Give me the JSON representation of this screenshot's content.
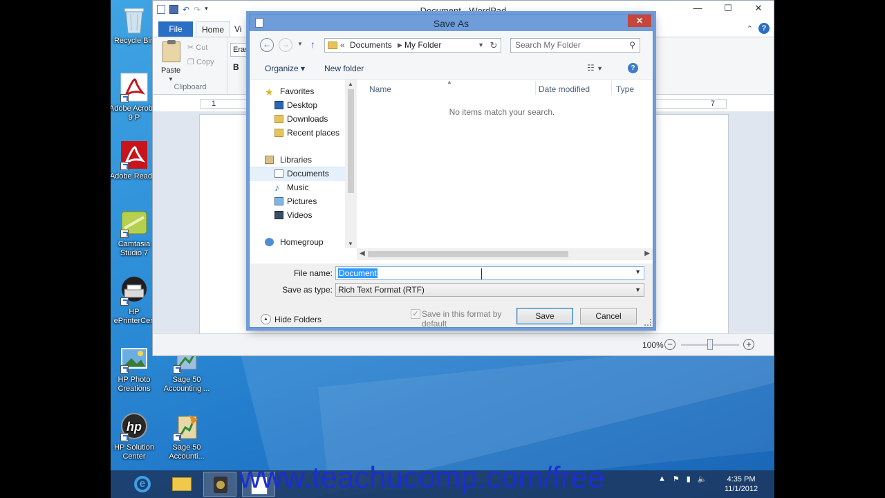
{
  "desktop": {
    "icons": [
      {
        "label": "Recycle Bin",
        "icon": "recycle-bin-icon"
      },
      {
        "label": "Adobe Acrobat 9 P",
        "icon": "adobe-acrobat-icon"
      },
      {
        "label": "Adobe Read 9",
        "icon": "adobe-reader-icon"
      },
      {
        "label": "Camtasia Studio 7",
        "icon": "camtasia-icon"
      },
      {
        "label": "HP ePrinterCen",
        "icon": "hp-printer-icon"
      },
      {
        "label": "HP Photo Creations",
        "icon": "hp-photo-icon"
      },
      {
        "label": "Sage 50 Accounting ...",
        "icon": "sage-icon"
      },
      {
        "label": "HP Solution Center",
        "icon": "hp-solution-icon"
      },
      {
        "label": "Sage 50 Accounti...",
        "icon": "sage-icon"
      }
    ]
  },
  "wordpad": {
    "title": "Document - WordPad",
    "tabs": {
      "file": "File",
      "home": "Home",
      "view": "Vi"
    },
    "clipboard": {
      "paste": "Paste",
      "cut": "Cut",
      "copy": "Copy",
      "group": "Clipboard"
    },
    "font_box": "Eras I",
    "bold": "B",
    "ruler": {
      "left": "1",
      "right": "7"
    },
    "zoom": {
      "level": "100%",
      "fraction": 0.5
    }
  },
  "dialog": {
    "title": "Save As",
    "close": "✕",
    "nav": {
      "back": "←",
      "forward": "→",
      "up": "↑",
      "breadcrumb_prefix": "«",
      "crumbs": [
        "Documents",
        "My Folder"
      ],
      "refresh": "↻",
      "search_placeholder": "Search My Folder"
    },
    "commands": {
      "organize": "Organize ▾",
      "new_folder": "New folder",
      "help": "?"
    },
    "nav_pane": {
      "favorites": "Favorites",
      "desktop": "Desktop",
      "downloads": "Downloads",
      "recent_places": "Recent places",
      "libraries": "Libraries",
      "documents": "Documents",
      "music": "Music",
      "pictures": "Pictures",
      "videos": "Videos",
      "homegroup": "Homegroup"
    },
    "columns": {
      "name": "Name",
      "date_modified": "Date modified",
      "type": "Type"
    },
    "empty_message": "No items match your search.",
    "file_name_label": "File name:",
    "file_name_value": "Document",
    "save_as_type_label": "Save as type:",
    "save_as_type_value": "Rich Text Format (RTF)",
    "hide_folders": "Hide Folders",
    "save_default_checkbox": "Save in this format by default",
    "save_button": "Save",
    "cancel_button": "Cancel"
  },
  "taskbar": {
    "watermark": "www.teachucomp.com/free",
    "time": "4:35 PM",
    "date": "11/1/2012"
  },
  "colors": {
    "desktop_blue": "#2d8ed8",
    "dialog_frame": "#6f9dd9",
    "close_red": "#c7453b",
    "selection_blue": "#3399ff",
    "file_tab_blue": "#2b6fc5"
  }
}
